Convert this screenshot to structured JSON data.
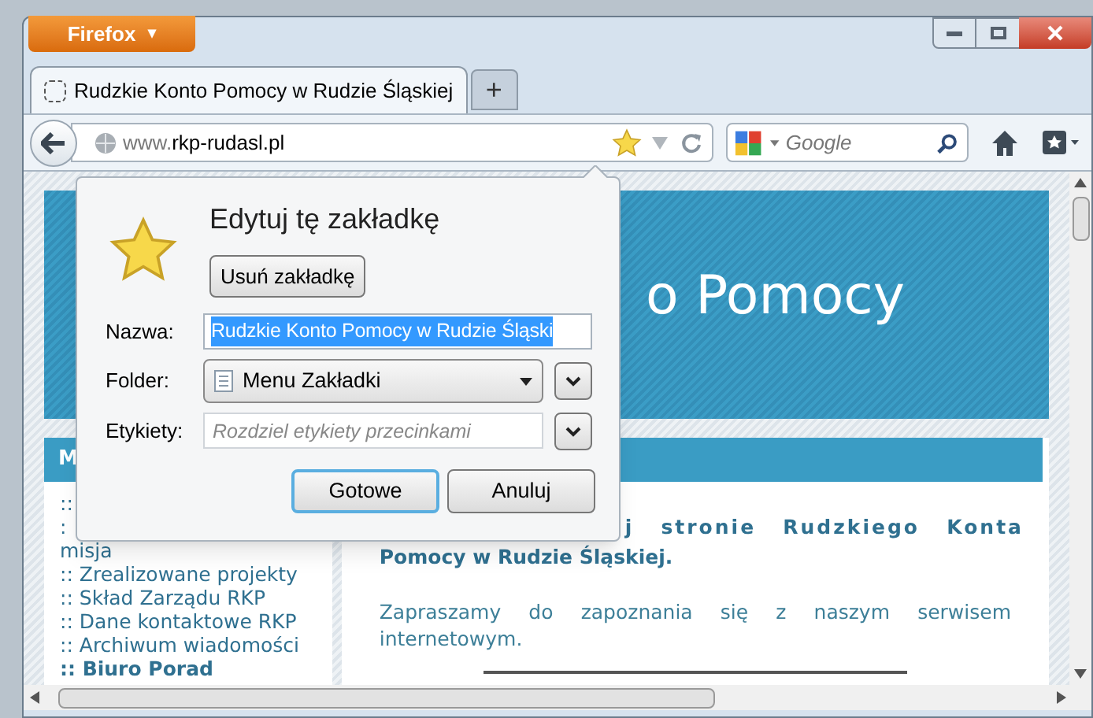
{
  "app_button": {
    "label": "Firefox",
    "caret": "▾"
  },
  "tabs": [
    {
      "title": "Rudzkie Konto Pomocy w Rudzie Śląskiej",
      "selected": true
    }
  ],
  "new_tab": "+",
  "address_bar": {
    "prefix": "www.",
    "domain": "rkp-rudasl.pl",
    "bookmarked": true
  },
  "search": {
    "placeholder": "Google"
  },
  "page": {
    "banner_title": "o Pomocy",
    "menu_header": "M",
    "menu_items": [
      {
        "label": "::",
        "bold": false
      },
      {
        "label": ":",
        "bold": false
      },
      {
        "label": "misja",
        "bold": false
      },
      {
        "label": ":: Zrealizowane projekty",
        "bold": false
      },
      {
        "label": ":: Skład Zarządu RKP",
        "bold": false
      },
      {
        "label": ":: Dane kontaktowe RKP",
        "bold": false
      },
      {
        "label": ":: Archiwum wiadomości",
        "bold": false
      },
      {
        "label": ":: Biuro Porad",
        "bold": true
      }
    ],
    "welcome_line_1": "j stronie Rudzkiego Konta",
    "welcome_line_2": "Pomocy w Rudzie Śląskiej.",
    "intro": "Zapraszamy do zapoznania się z naszym serwisem internetowym."
  },
  "bookmark_popup": {
    "title": "Edytuj tę zakładkę",
    "remove_button": "Usuń zakładkę",
    "name": {
      "label": "Nazwa:",
      "value": "Rudzkie Konto Pomocy w Rudzie Śląski",
      "selected": true
    },
    "folder": {
      "label": "Folder:",
      "value": "Menu Zakładki"
    },
    "tags": {
      "label": "Etykiety:",
      "placeholder": "Rozdziel etykiety przecinkami"
    },
    "buttons": [
      {
        "label": "Gotowe",
        "focused": true
      },
      {
        "label": "Anuluj",
        "focused": false
      }
    ]
  }
}
